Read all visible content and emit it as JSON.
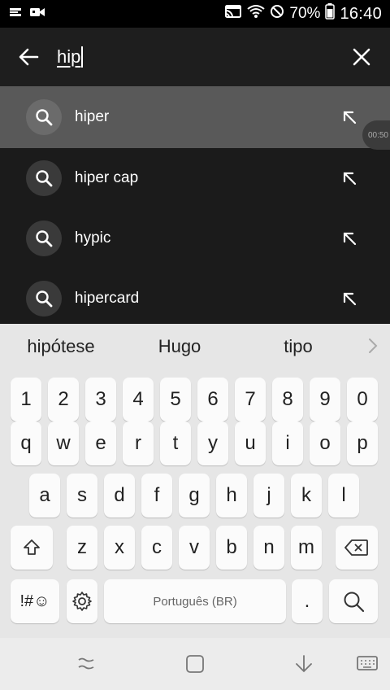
{
  "status_bar": {
    "battery_percent": "70%",
    "time": "16:40",
    "left_icons": [
      "screen-cast-icon",
      "video-camera-icon"
    ],
    "right_icons": [
      "cast-icon",
      "wifi-icon",
      "do-not-disturb-icon",
      "battery-icon"
    ]
  },
  "search": {
    "query": "hip"
  },
  "suggestions": [
    {
      "label": "hiper"
    },
    {
      "label": "hiper cap"
    },
    {
      "label": "hypic"
    },
    {
      "label": "hipercard"
    }
  ],
  "overlay_timer": "00:50",
  "keyboard": {
    "predictions": [
      "hipótese",
      "Hugo",
      "tipo"
    ],
    "number_row": [
      "1",
      "2",
      "3",
      "4",
      "5",
      "6",
      "7",
      "8",
      "9",
      "0"
    ],
    "row1": [
      "q",
      "w",
      "e",
      "r",
      "t",
      "y",
      "u",
      "i",
      "o",
      "p"
    ],
    "row2": [
      "a",
      "s",
      "d",
      "f",
      "g",
      "h",
      "j",
      "k",
      "l"
    ],
    "row3": [
      "z",
      "x",
      "c",
      "v",
      "b",
      "n",
      "m"
    ],
    "symbols_label": "!#☺",
    "space_label": "Português (BR)",
    "period_label": "."
  },
  "colors": {
    "header_bg": "#1e1e1e",
    "list_bg": "#1b1b1b",
    "highlight_bg": "#595959",
    "keyboard_bg": "#e6e6e6",
    "key_bg": "#fbfbfb"
  }
}
